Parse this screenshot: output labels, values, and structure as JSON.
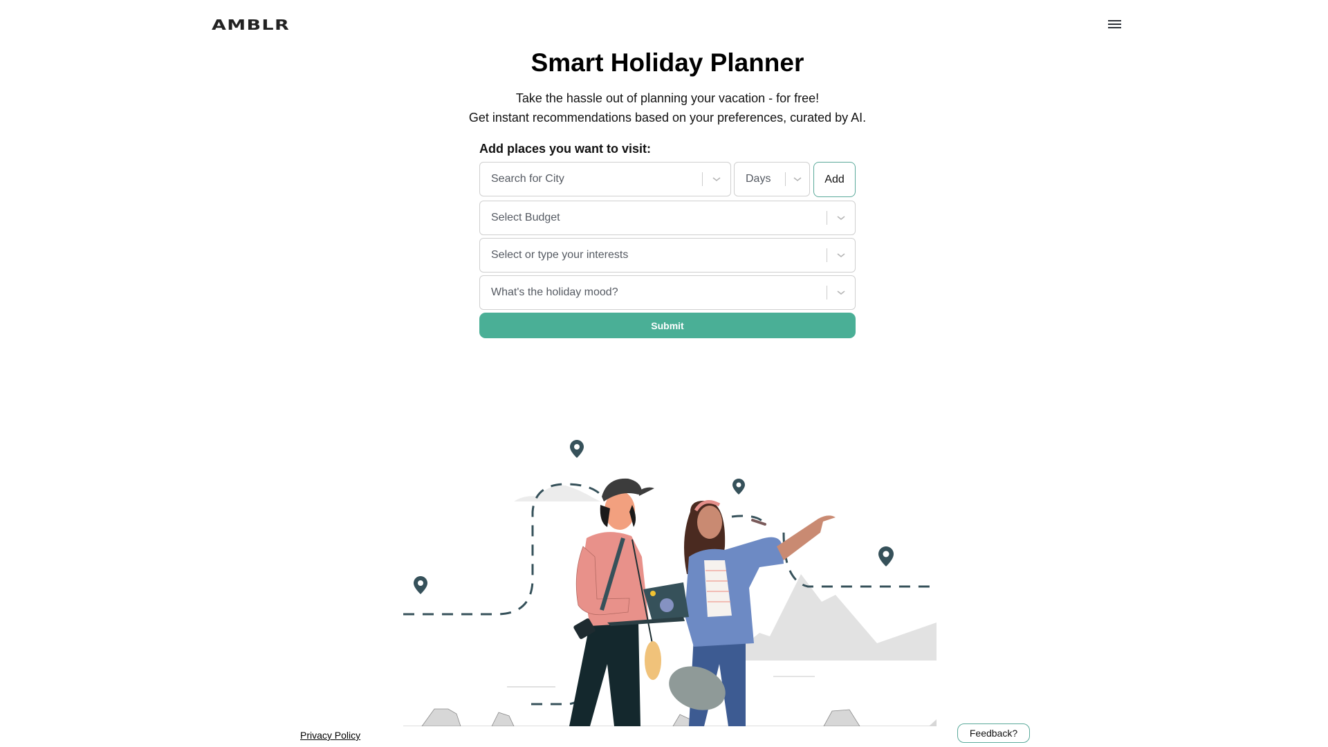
{
  "header": {
    "logo": "AMBLR",
    "menu_icon": "hamburger-menu-icon"
  },
  "hero": {
    "title": "Smart Holiday Planner",
    "subtitle_line1": "Take the hassle out of planning your vacation - for free!",
    "subtitle_line2": "Get instant recommendations based on your preferences, curated by AI."
  },
  "form": {
    "label": "Add places you want to visit:",
    "city": {
      "placeholder": "Search for City",
      "icon": "chevron-down-icon"
    },
    "days": {
      "placeholder": "Days",
      "icon": "chevron-down-icon"
    },
    "add_label": "Add",
    "budget": {
      "placeholder": "Select Budget",
      "icon": "chevron-down-icon"
    },
    "interests": {
      "placeholder": "Select or type your interests",
      "icon": "chevron-down-icon"
    },
    "mood": {
      "placeholder": "What's the holiday mood?",
      "icon": "chevron-down-icon"
    },
    "submit_label": "Submit"
  },
  "footer": {
    "privacy_label": "Privacy Policy",
    "feedback_label": "Feedback?"
  },
  "colors": {
    "accent": "#4aaf96",
    "accent_border": "#5aa99a",
    "pin": "#36515a"
  }
}
